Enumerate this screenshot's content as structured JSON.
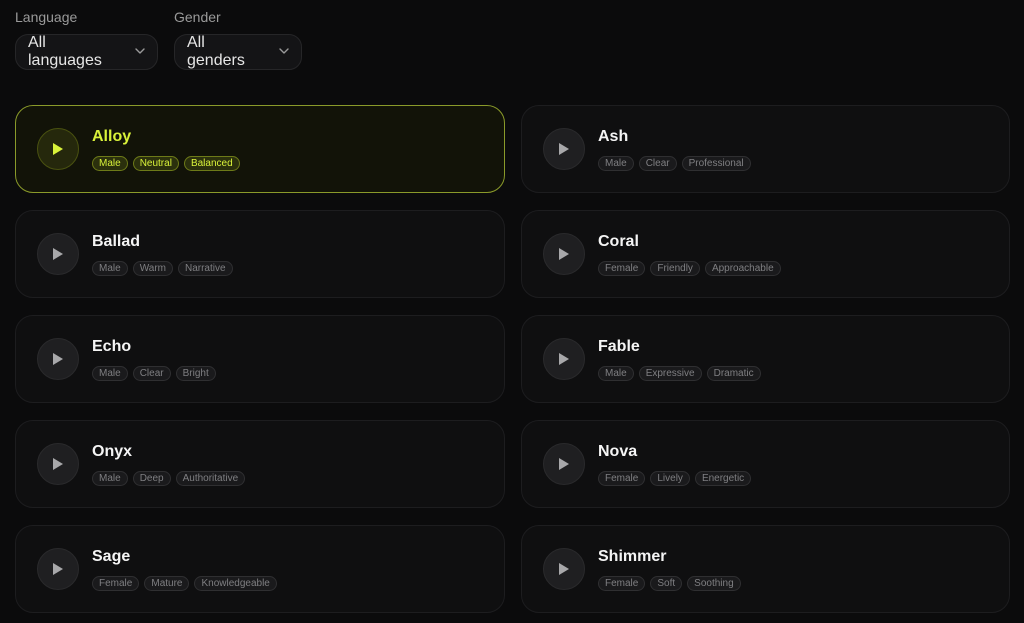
{
  "filters": {
    "language": {
      "label": "Language",
      "value": "All languages"
    },
    "gender": {
      "label": "Gender",
      "value": "All genders"
    }
  },
  "accent_color": "#d9f23a",
  "voices": [
    {
      "name": "Alloy",
      "tags": [
        "Male",
        "Neutral",
        "Balanced"
      ],
      "selected": true
    },
    {
      "name": "Ash",
      "tags": [
        "Male",
        "Clear",
        "Professional"
      ]
    },
    {
      "name": "Ballad",
      "tags": [
        "Male",
        "Warm",
        "Narrative"
      ]
    },
    {
      "name": "Coral",
      "tags": [
        "Female",
        "Friendly",
        "Approachable"
      ]
    },
    {
      "name": "Echo",
      "tags": [
        "Male",
        "Clear",
        "Bright"
      ]
    },
    {
      "name": "Fable",
      "tags": [
        "Male",
        "Expressive",
        "Dramatic"
      ]
    },
    {
      "name": "Onyx",
      "tags": [
        "Male",
        "Deep",
        "Authoritative"
      ]
    },
    {
      "name": "Nova",
      "tags": [
        "Female",
        "Lively",
        "Energetic"
      ]
    },
    {
      "name": "Sage",
      "tags": [
        "Female",
        "Mature",
        "Knowledgeable"
      ]
    },
    {
      "name": "Shimmer",
      "tags": [
        "Female",
        "Soft",
        "Soothing"
      ]
    }
  ]
}
